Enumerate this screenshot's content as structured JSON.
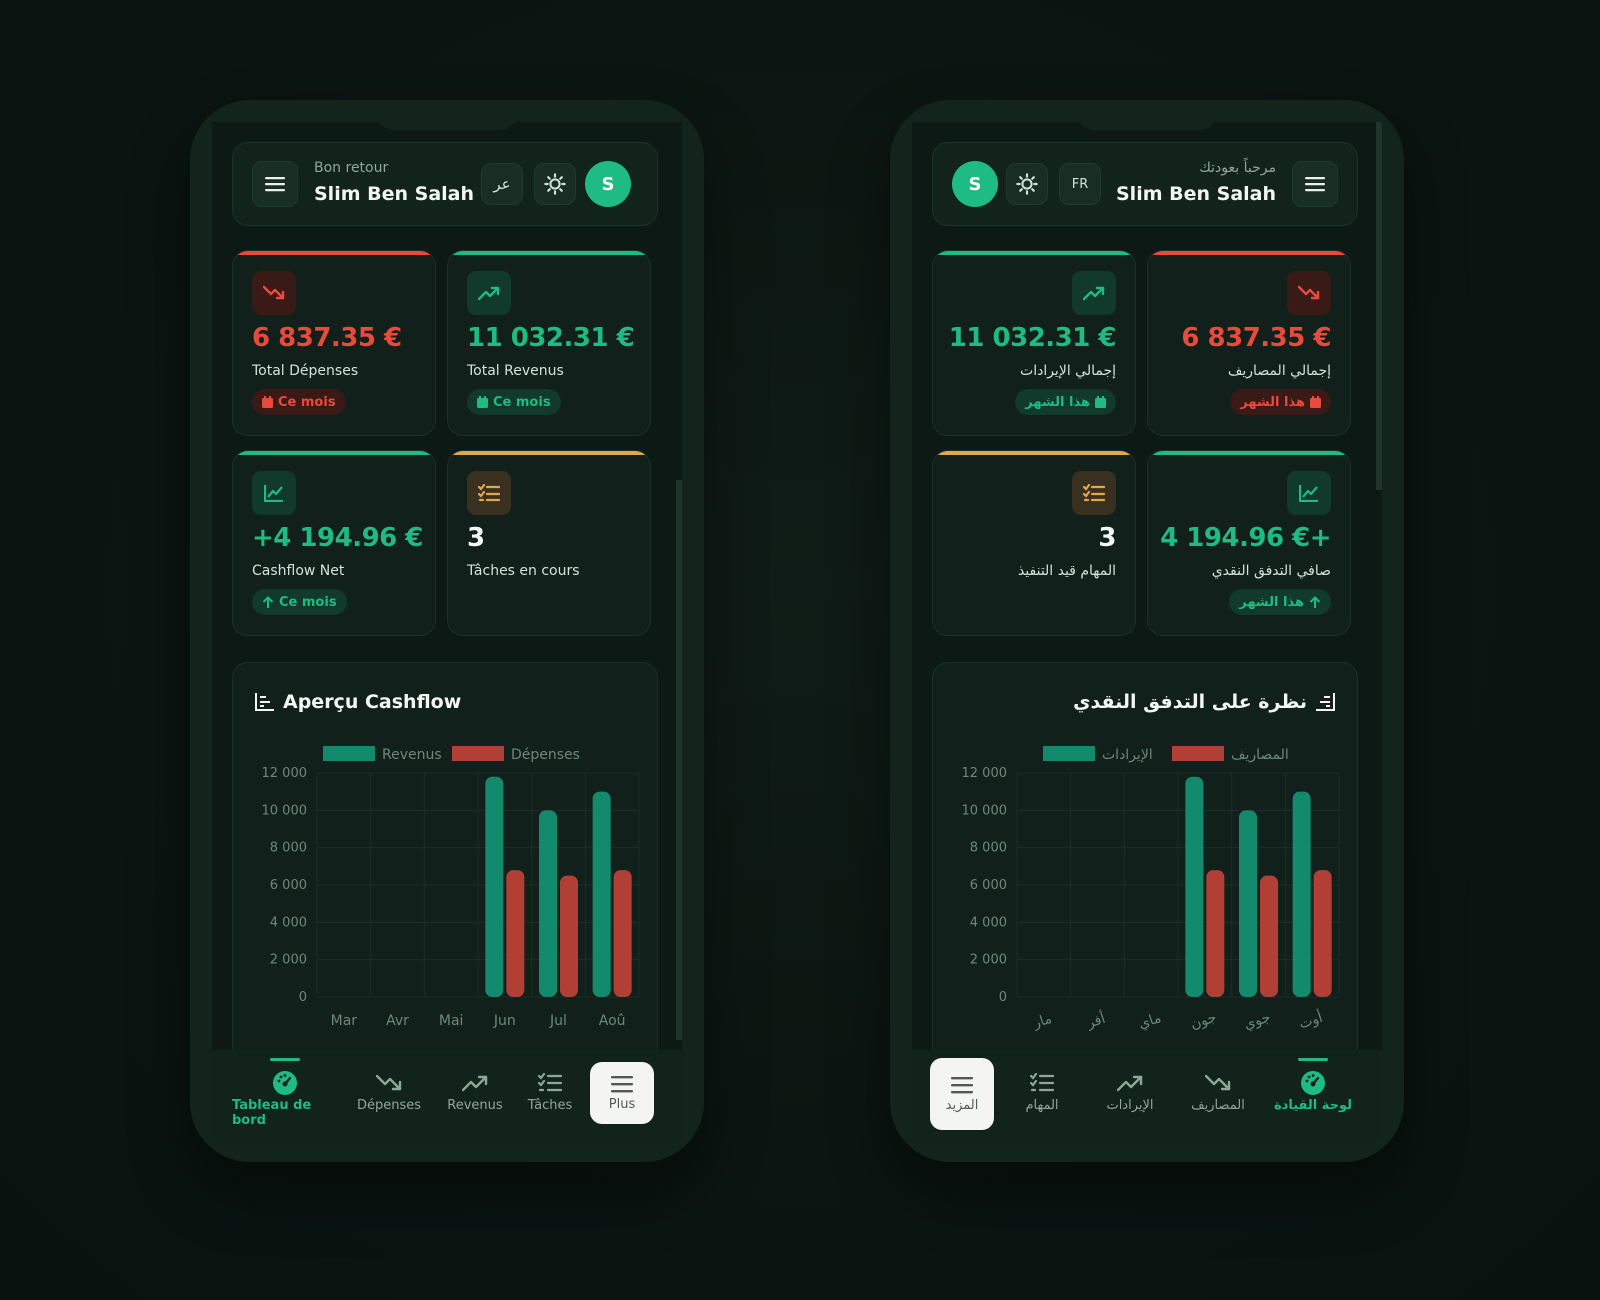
{
  "colors": {
    "accent": "#1fbb84",
    "danger": "#ea4a3c",
    "warning": "#e0a84a",
    "revenue_bar": "#138a6b",
    "expense_bar": "#b13f35"
  },
  "fr": {
    "header": {
      "greeting": "Bon retour",
      "user_name": "Slim Ben Salah",
      "lang_button": "عر",
      "avatar_initial": "S"
    },
    "cards": {
      "expenses": {
        "value": "6 837.35 €",
        "label": "Total Dépenses",
        "pill": "Ce mois"
      },
      "revenue": {
        "value": "11 032.31 €",
        "label": "Total Revenus",
        "pill": "Ce mois"
      },
      "cashflow": {
        "value": "+4 194.96 €",
        "label": "Cashflow Net",
        "pill": "Ce mois"
      },
      "tasks": {
        "value": "3",
        "label": "Tâches en cours"
      }
    },
    "chart_title": "Aperçu Cashflow",
    "nav": {
      "dashboard": "Tableau de bord",
      "expenses": "Dépenses",
      "revenue": "Revenus",
      "tasks": "Tâches",
      "more": "Plus"
    }
  },
  "ar": {
    "header": {
      "greeting": "مرحباً بعودتك",
      "user_name": "Slim Ben Salah",
      "lang_button": "FR",
      "avatar_initial": "S"
    },
    "cards": {
      "revenue": {
        "value": "11 032.31 €",
        "label": "إجمالي الإيرادات",
        "pill": "هذا الشهر"
      },
      "expenses": {
        "value": "6 837.35 €",
        "label": "إجمالي المصاريف",
        "pill": "هذا الشهر"
      },
      "tasks": {
        "value": "3",
        "label": "المهام قيد التنفيذ"
      },
      "cashflow": {
        "value": "4 194.96 €+",
        "label": "صافي التدفق النقدي",
        "pill": "هذا الشهر"
      }
    },
    "chart_title": "نظرة على التدفق النقدي",
    "nav": {
      "dashboard": "لوحة القيادة",
      "expenses": "المصاريف",
      "revenue": "الإيرادات",
      "tasks": "المهام",
      "more": "المزيد"
    }
  },
  "chart_data": [
    {
      "type": "bar",
      "title": "Aperçu Cashflow",
      "categories": [
        "Mar",
        "Avr",
        "Mai",
        "Jun",
        "Jul",
        "Aoû"
      ],
      "series": [
        {
          "name": "Revenus",
          "values": [
            0,
            0,
            0,
            11800,
            10000,
            11000
          ]
        },
        {
          "name": "Dépenses",
          "values": [
            0,
            0,
            0,
            6800,
            6500,
            6800
          ]
        }
      ],
      "ylim": [
        0,
        12000
      ],
      "y_ticks": [
        "0",
        "2 000",
        "4 000",
        "6 000",
        "8 000",
        "10 000",
        "12 000"
      ],
      "grid": true,
      "legend": "top"
    },
    {
      "type": "bar",
      "title": "نظرة على التدفق النقدي",
      "categories": [
        "مار",
        "أفر",
        "ماي",
        "جون",
        "جوي",
        "أوت"
      ],
      "series": [
        {
          "name": "الإيرادات",
          "values": [
            0,
            0,
            0,
            11800,
            10000,
            11000
          ]
        },
        {
          "name": "المصاريف",
          "values": [
            0,
            0,
            0,
            6800,
            6500,
            6800
          ]
        }
      ],
      "ylim": [
        0,
        12000
      ],
      "y_ticks": [
        "0",
        "2 000",
        "4 000",
        "6 000",
        "8 000",
        "10 000",
        "12 000"
      ],
      "grid": true,
      "legend": "top"
    }
  ]
}
